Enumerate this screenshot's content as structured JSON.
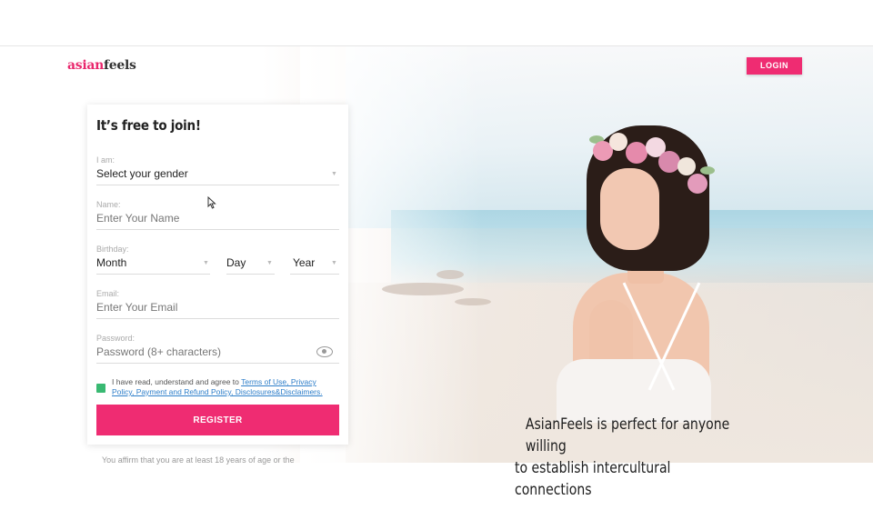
{
  "header": {
    "logo_part1": "asian",
    "logo_part2": "feels",
    "login_label": "LOGIN"
  },
  "form": {
    "title": "It’s free to join!",
    "gender": {
      "label": "I am:",
      "value": "Select your gender"
    },
    "name": {
      "label": "Name:",
      "placeholder": "Enter Your Name"
    },
    "birthday": {
      "label": "Birthday:",
      "month": "Month",
      "day": "Day",
      "year": "Year"
    },
    "email": {
      "label": "Email:",
      "placeholder": "Enter Your Email"
    },
    "password": {
      "label": "Password:",
      "placeholder": "Password (8+ characters)"
    },
    "terms_text": "I have read, understand and agree to ",
    "terms_link": "Terms of Use, Privacy Policy, Payment and Refund Policy, Disclosures&Disclaimers.",
    "register_label": "REGISTER",
    "affirm": "You affirm that you are at least 18 years of age or the"
  },
  "hero": {
    "tagline_line1": "AsianFeels is perfect for anyone willing",
    "tagline_line2": "to establish intercultural connections"
  },
  "colors": {
    "accent": "#ef2c72",
    "checkbox": "#39b972",
    "link": "#2d7ec9"
  }
}
